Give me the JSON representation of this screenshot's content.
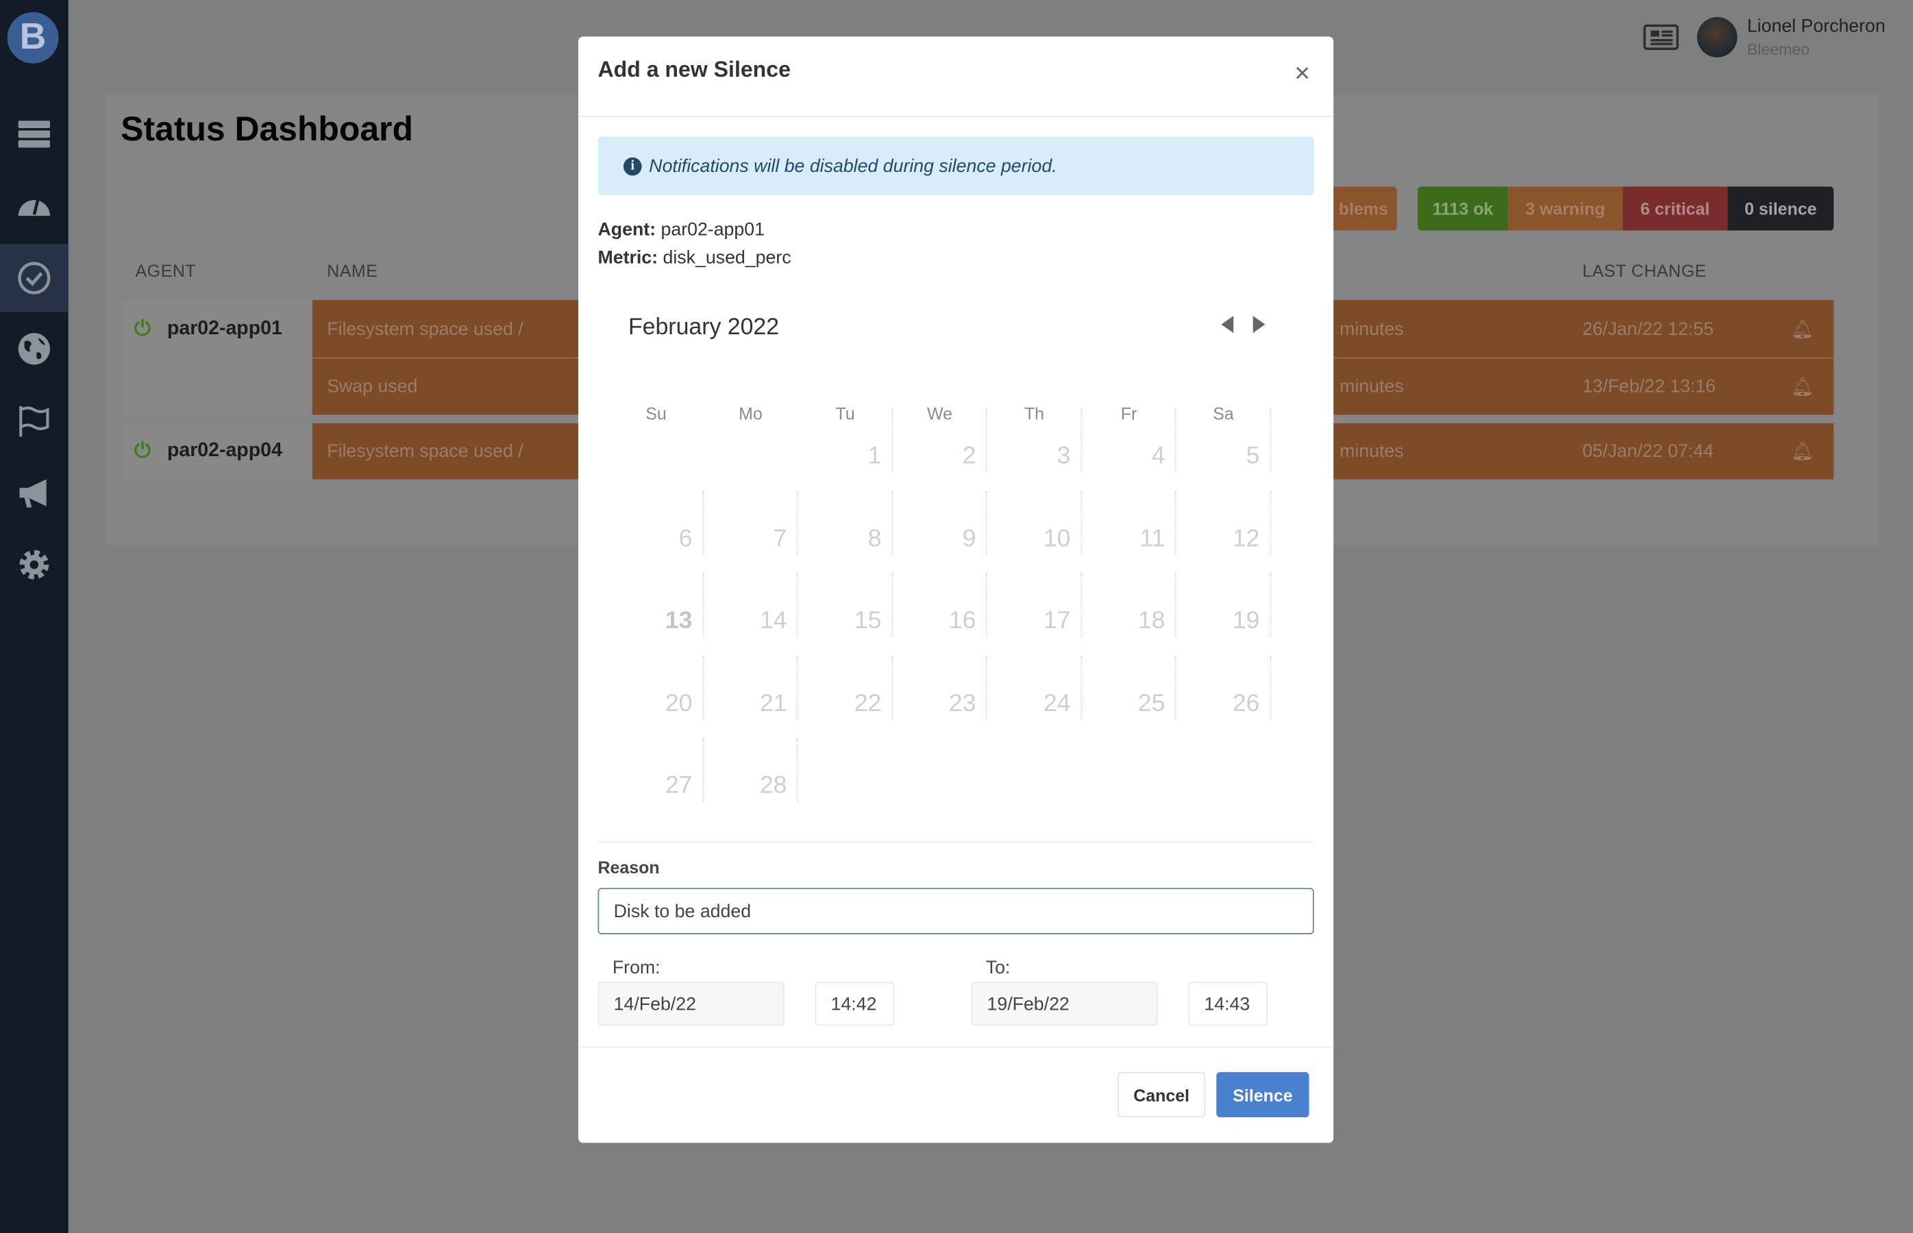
{
  "header": {
    "user_name": "Lionel Porcheron",
    "organization": "Bleemeo",
    "icons": [
      "newspaper-icon",
      "avatar"
    ]
  },
  "sidebar": {
    "logo": "B",
    "items": [
      {
        "icon": "server-icon"
      },
      {
        "icon": "dashboard-gauge-icon"
      },
      {
        "icon": "check-circle-icon",
        "active": true
      },
      {
        "icon": "globe-icon"
      },
      {
        "icon": "flag-icon"
      },
      {
        "icon": "megaphone-icon"
      },
      {
        "icon": "gear-icon"
      }
    ]
  },
  "dashboard": {
    "title": "Status Dashboard",
    "badges": [
      {
        "label": "blems",
        "color": "#8a552d"
      },
      {
        "label": "1113 ok",
        "color": "#3d6b1a"
      },
      {
        "label": "3 warning",
        "color": "#8a552d"
      },
      {
        "label": "6 critical",
        "color": "#7a2c2c"
      },
      {
        "label": "0 silence",
        "color": "#1f2024"
      }
    ],
    "columns": {
      "agent": "AGENT",
      "name": "NAME",
      "last_change": "LAST CHANGE"
    },
    "rows": [
      {
        "agent": "par02-app01",
        "name": "Filesystem space used /",
        "duration": "minutes",
        "last_change": "26/Jan/22 12:55"
      },
      {
        "agent": "",
        "name": "Swap used",
        "duration": "minutes",
        "last_change": "13/Feb/22 13:16"
      },
      {
        "agent": "par02-app04",
        "name": "Filesystem space used /",
        "duration": "minutes",
        "last_change": "05/Jan/22 07:44"
      }
    ]
  },
  "modal": {
    "title": "Add a new Silence",
    "close": "×",
    "info": "Notifications will be disabled during silence period.",
    "agent_label": "Agent:",
    "agent_value": "par02-app01",
    "metric_label": "Metric:",
    "metric_value": "disk_used_perc",
    "calendar": {
      "month": "February 2022",
      "weekdays": [
        "Su",
        "Mo",
        "Tu",
        "We",
        "Th",
        "Fr",
        "Sa"
      ],
      "first_weekday": 2,
      "days": 28,
      "today": 13
    },
    "reason_label": "Reason",
    "reason_value": "Disk to be added",
    "from_label": "From:",
    "from_date": "14/Feb/22",
    "from_time": "14:42",
    "to_label": "To:",
    "to_date": "19/Feb/22",
    "to_time": "14:43",
    "cancel": "Cancel",
    "submit": "Silence",
    "accent": "#4a80d0"
  }
}
